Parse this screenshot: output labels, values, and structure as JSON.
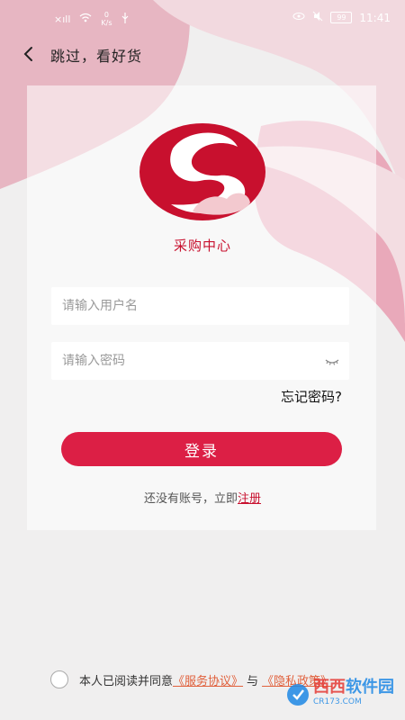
{
  "status_bar": {
    "signal_text": "×ıll",
    "speed_value": "0",
    "speed_unit": "K/s",
    "battery": "99",
    "time": "11:41"
  },
  "header": {
    "back_icon": "chevron-left-icon",
    "skip_label": "跳过，看好货"
  },
  "brand": {
    "name": "采购中心",
    "logo_color": "#c8102e"
  },
  "form": {
    "username_placeholder": "请输入用户名",
    "password_placeholder": "请输入密码",
    "forgot_label": "忘记密码?",
    "login_label": "登录",
    "no_account_text": "还没有账号，立即",
    "register_label": "注册"
  },
  "agreement": {
    "prefix": "本人已阅读并同意",
    "service_link": "《服务协议》",
    "connector": "与",
    "privacy_link": "《隐私政策》"
  },
  "watermark": {
    "logo_text": "西西",
    "site_name": "软件园",
    "domain": "CR173.COM"
  },
  "colors": {
    "accent": "#dc1f45",
    "link": "#c8102e",
    "background": "#f0efef"
  }
}
